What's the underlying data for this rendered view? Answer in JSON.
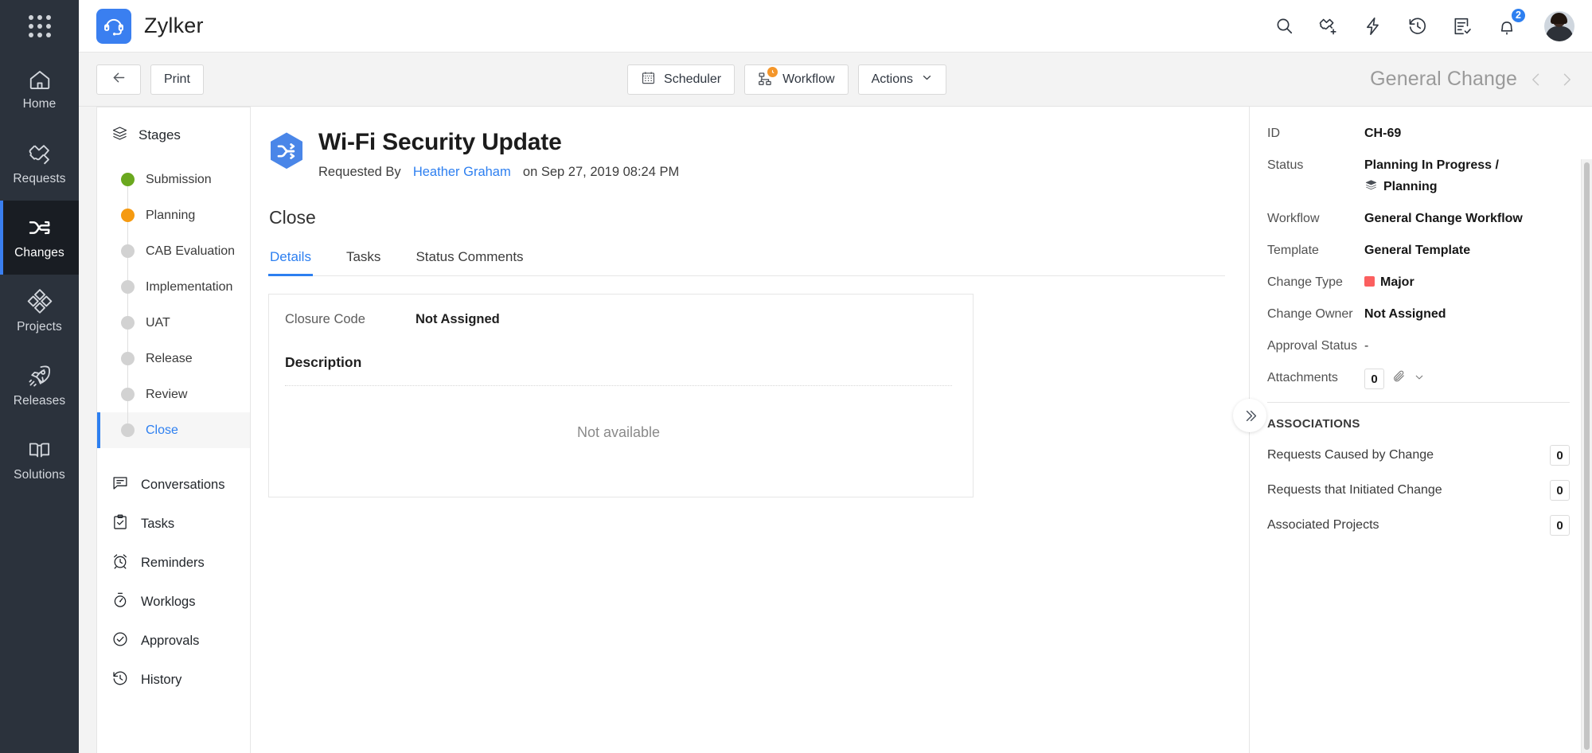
{
  "brand": {
    "name": "Zylker",
    "logo_icon": "headset-icon",
    "apps_icon": "app-grid-icon"
  },
  "topbar": {
    "icons": [
      {
        "name": "search-icon",
        "label": "Search"
      },
      {
        "name": "add-ticket-icon",
        "label": "Add Request"
      },
      {
        "name": "flash-icon",
        "label": "Quick Actions"
      },
      {
        "name": "history-icon",
        "label": "Recent Items"
      },
      {
        "name": "task-list-icon",
        "label": "My Tasks"
      }
    ],
    "notifications": {
      "icon": "bell-icon",
      "count": "2",
      "badge_color": "#2d7ff0"
    },
    "avatar": {
      "name": "user-avatar"
    }
  },
  "rail": {
    "items": [
      {
        "label": "Home",
        "icon": "home-icon",
        "active": false
      },
      {
        "label": "Requests",
        "icon": "ticket-icon",
        "active": false
      },
      {
        "label": "Changes",
        "icon": "changes-icon",
        "active": true
      },
      {
        "label": "Projects",
        "icon": "projects-icon",
        "active": false
      },
      {
        "label": "Releases",
        "icon": "rocket-icon",
        "active": false
      },
      {
        "label": "Solutions",
        "icon": "book-icon",
        "active": false
      }
    ],
    "active_color": "#3a7ff0"
  },
  "toolbar": {
    "back_icon": "arrow-left-icon",
    "print_label": "Print",
    "scheduler_label": "Scheduler",
    "scheduler_icon": "calendar-icon",
    "workflow_label": "Workflow",
    "workflow_icon": "workflow-icon",
    "actions_label": "Actions",
    "actions_caret": "chevron-down-icon",
    "breadcrumb_title": "General Change",
    "prev_icon": "chevron-left-icon",
    "next_icon": "chevron-right-icon"
  },
  "stages_panel": {
    "header_label": "Stages",
    "header_icon": "layers-icon",
    "stages": [
      {
        "label": "Submission",
        "color": "#6aa81e",
        "state": "completed"
      },
      {
        "label": "Planning",
        "color": "#f59a11",
        "state": "in-progress"
      },
      {
        "label": "CAB Evaluation",
        "color": "#d2d2d2",
        "state": "pending"
      },
      {
        "label": "Implementation",
        "color": "#d2d2d2",
        "state": "pending"
      },
      {
        "label": "UAT",
        "color": "#d2d2d2",
        "state": "pending"
      },
      {
        "label": "Release",
        "color": "#d2d2d2",
        "state": "pending"
      },
      {
        "label": "Review",
        "color": "#d2d2d2",
        "state": "pending"
      },
      {
        "label": "Close",
        "color": "#d2d2d2",
        "state": "current"
      }
    ],
    "links": [
      {
        "label": "Conversations",
        "icon": "conversation-icon"
      },
      {
        "label": "Tasks",
        "icon": "clipboard-check-icon"
      },
      {
        "label": "Reminders",
        "icon": "alarm-clock-icon"
      },
      {
        "label": "Worklogs",
        "icon": "stopwatch-icon"
      },
      {
        "label": "Approvals",
        "icon": "check-circle-icon"
      },
      {
        "label": "History",
        "icon": "history-clock-icon"
      }
    ]
  },
  "record": {
    "icon": "change-hex-icon",
    "title": "Wi-Fi Security Update",
    "requested_by_prefix": "Requested By",
    "requested_by_name": "Heather Graham",
    "requested_on": "on Sep 27, 2019 08:24 PM",
    "stage_name": "Close",
    "tabs": [
      {
        "label": "Details",
        "active": true
      },
      {
        "label": "Tasks",
        "active": false
      },
      {
        "label": "Status Comments",
        "active": false
      }
    ],
    "closure_code_label": "Closure Code",
    "closure_code_value": "Not Assigned",
    "description_label": "Description",
    "description_value": "Not available"
  },
  "details_panel": {
    "collapse_icon": "chevron-double-right-icon",
    "properties": [
      {
        "label": "ID",
        "value": "CH-69"
      },
      {
        "label": "Status",
        "value": "Planning In Progress /",
        "value_line2": "Planning",
        "line2_icon": "layers-icon"
      },
      {
        "label": "Workflow",
        "value": "General Change Workflow"
      },
      {
        "label": "Template",
        "value": "General Template"
      },
      {
        "label": "Change Type",
        "value": "Major",
        "swatch_color": "#fb5f5f"
      },
      {
        "label": "Change Owner",
        "value": "Not Assigned"
      },
      {
        "label": "Approval Status",
        "value": "-"
      }
    ],
    "attachments": {
      "label": "Attachments",
      "count": "0",
      "icon": "paperclip-icon",
      "caret": "chevron-down-icon"
    },
    "associations_title": "ASSOCIATIONS",
    "associations": [
      {
        "label": "Requests Caused by Change",
        "count": "0"
      },
      {
        "label": "Requests that Initiated Change",
        "count": "0"
      },
      {
        "label": "Associated Projects",
        "count": "0"
      }
    ]
  }
}
